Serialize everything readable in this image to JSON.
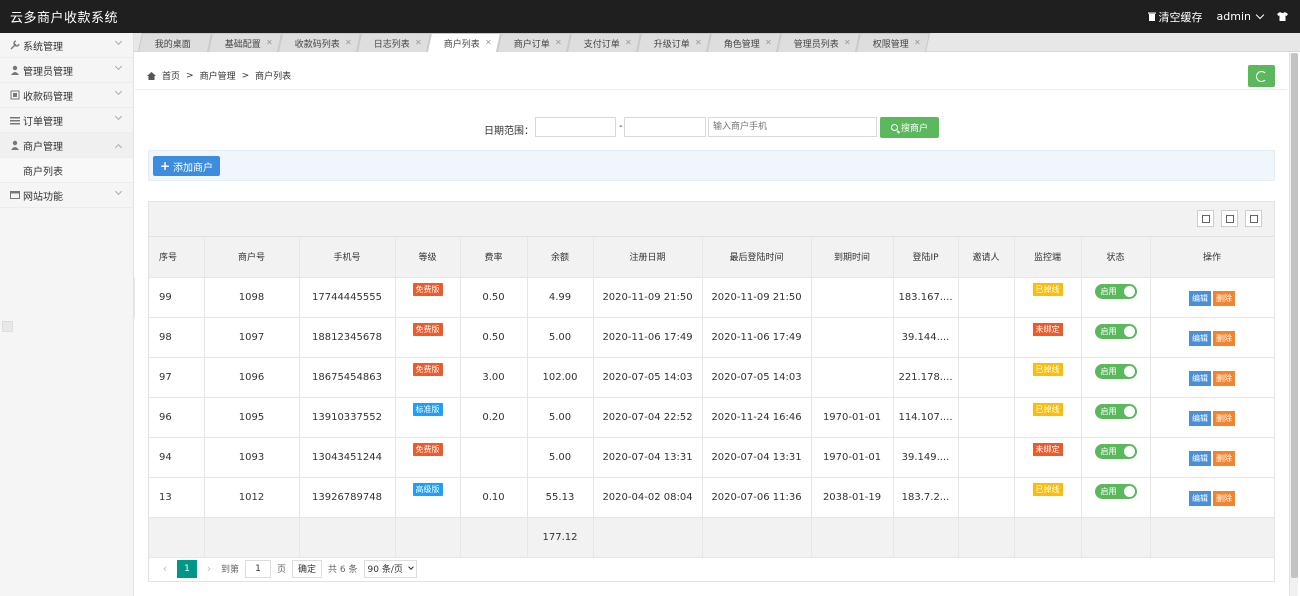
{
  "app": {
    "title": "云多商户收款系统"
  },
  "topbar": {
    "clear_cache": "清空缓存",
    "user": "admin"
  },
  "sidebar": {
    "items": [
      {
        "label": "系统管理",
        "icon": "wrench-icon"
      },
      {
        "label": "管理员管理",
        "icon": "user-icon"
      },
      {
        "label": "收款码管理",
        "icon": "qrcode-icon"
      },
      {
        "label": "订单管理",
        "icon": "list-icon"
      },
      {
        "label": "商户管理",
        "icon": "user-icon"
      },
      {
        "label": "网站功能",
        "icon": "window-icon"
      }
    ],
    "sub_item": "商户列表"
  },
  "tabs": [
    "我的桌面",
    "基础配置",
    "收款码列表",
    "日志列表",
    "商户列表",
    "商户订单",
    "支付订单",
    "升级订单",
    "角色管理",
    "管理员列表",
    "权限管理"
  ],
  "breadcrumb": [
    "首页",
    "商户管理",
    "商户列表"
  ],
  "search": {
    "label": "日期范围：",
    "dash": "-",
    "phone_placeholder": "输入商户手机",
    "button": "搜商户"
  },
  "add_button": "添加商户",
  "table": {
    "headers": [
      "序号",
      "商户号",
      "手机号",
      "等级",
      "费率",
      "余额",
      "注册日期",
      "最后登陆时间",
      "到期时间",
      "登陆IP",
      "邀请人",
      "监控端",
      "状态",
      "操作"
    ],
    "rows": [
      {
        "id": "99",
        "merchant": "1098",
        "phone": "17744445555",
        "level": "免费版",
        "level_type": "free",
        "rate": "0.50",
        "balance": "4.99",
        "reg": "2020-11-09 21:50",
        "last": "2020-11-09 21:50",
        "expire": "",
        "ip": "183.167....",
        "inviter": "",
        "monitor": "已掉线",
        "monitor_type": "on",
        "status": "启用"
      },
      {
        "id": "98",
        "merchant": "1097",
        "phone": "18812345678",
        "level": "免费版",
        "level_type": "free",
        "rate": "0.50",
        "balance": "5.00",
        "reg": "2020-11-06 17:49",
        "last": "2020-11-06 17:49",
        "expire": "",
        "ip": "39.144....",
        "inviter": "",
        "monitor": "未绑定",
        "monitor_type": "off",
        "status": "启用"
      },
      {
        "id": "97",
        "merchant": "1096",
        "phone": "18675454863",
        "level": "免费版",
        "level_type": "free",
        "rate": "3.00",
        "balance": "102.00",
        "reg": "2020-07-05 14:03",
        "last": "2020-07-05 14:03",
        "expire": "",
        "ip": "221.178....",
        "inviter": "",
        "monitor": "已掉线",
        "monitor_type": "on",
        "status": "启用"
      },
      {
        "id": "96",
        "merchant": "1095",
        "phone": "13910337552",
        "level": "标准版",
        "level_type": "std",
        "rate": "0.20",
        "balance": "5.00",
        "reg": "2020-07-04 22:52",
        "last": "2020-11-24 16:46",
        "expire": "1970-01-01",
        "ip": "114.107....",
        "inviter": "",
        "monitor": "已掉线",
        "monitor_type": "on",
        "status": "启用"
      },
      {
        "id": "94",
        "merchant": "1093",
        "phone": "13043451244",
        "level": "免费版",
        "level_type": "free",
        "rate": "",
        "balance": "5.00",
        "reg": "2020-07-04 13:31",
        "last": "2020-07-04 13:31",
        "expire": "1970-01-01",
        "ip": "39.149....",
        "inviter": "",
        "monitor": "未绑定",
        "monitor_type": "off",
        "status": "启用"
      },
      {
        "id": "13",
        "merchant": "1012",
        "phone": "13926789748",
        "level": "高级版",
        "level_type": "adv",
        "rate": "0.10",
        "balance": "55.13",
        "reg": "2020-04-02 08:04",
        "last": "2020-07-06 11:36",
        "expire": "2038-01-19",
        "ip": "183.7.2...",
        "inviter": "",
        "monitor": "已掉线",
        "monitor_type": "on",
        "status": "启用"
      }
    ],
    "sum_balance": "177.12",
    "edit_label": "编辑",
    "delete_label": "删除"
  },
  "pager": {
    "current": "1",
    "goto": "到第",
    "page_value": "1",
    "page_unit": "页",
    "confirm": "确定",
    "total": "共 6 条",
    "per_page": "90 条/页"
  },
  "colors": {
    "accent_green": "#5cb85c",
    "primary_blue": "#3c8dde",
    "pager_teal": "#009688"
  }
}
